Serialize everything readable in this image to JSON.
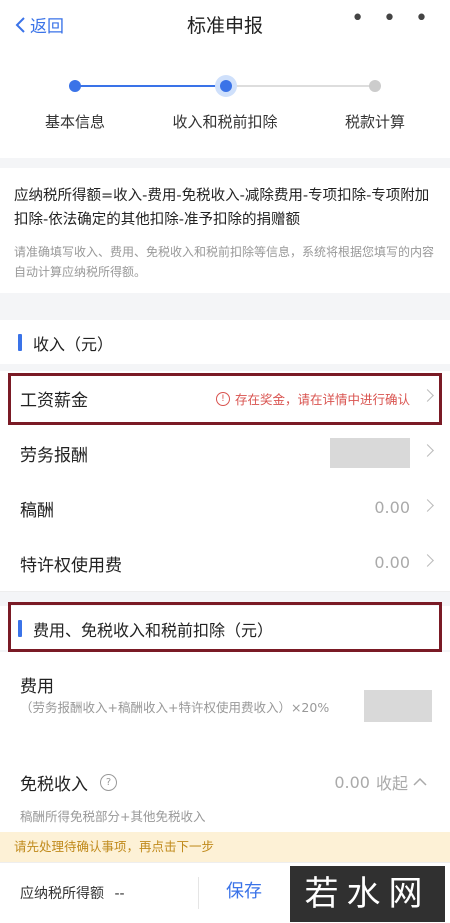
{
  "nav": {
    "back_label": "返回",
    "title": "标准申报",
    "more": "• • •"
  },
  "steps": [
    {
      "label": "基本信息",
      "state": "done"
    },
    {
      "label": "收入和税前扣除",
      "state": "current"
    },
    {
      "label": "税款计算",
      "state": "pending"
    }
  ],
  "formula": "应纳税所得额=收入-费用-免税收入-减除费用-专项扣除-专项附加扣除-依法确定的其他扣除-准予扣除的捐赠额",
  "hint": "请准确填写收入、费用、免税收入和税前扣除等信息，系统将根据您填写的内容自动计算应纳税所得额。",
  "income_section": {
    "title": "收入（元）",
    "rows": [
      {
        "label": "工资薪金",
        "warning": "存在奖金，请在详情中进行确认"
      },
      {
        "label": "劳务报酬",
        "value": ""
      },
      {
        "label": "稿酬",
        "value": "0.00"
      },
      {
        "label": "特许权使用费",
        "value": "0.00"
      }
    ]
  },
  "deduction_section": {
    "title": "费用、免税收入和税前扣除（元）",
    "fee_label": "费用",
    "fee_formula": "（劳务报酬收入+稿酬收入+特许权使用费收入）×20%",
    "taxfree_label": "免税收入",
    "taxfree_value": "0.00",
    "taxfree_toggle": "收起",
    "taxfree_note": "稿酬所得免税部分+其他免税收入"
  },
  "notice": "请先处理待确认事项，再点击下一步",
  "bottom": {
    "taxable_label": "应纳税所得额",
    "taxable_value": "--",
    "save_label": "保存"
  },
  "watermark": "若水网",
  "colors": {
    "accent": "#3a73e8",
    "warning": "#d9534f",
    "highlight_frame": "#7a1a25",
    "notice_bg": "#fdf1d6"
  }
}
